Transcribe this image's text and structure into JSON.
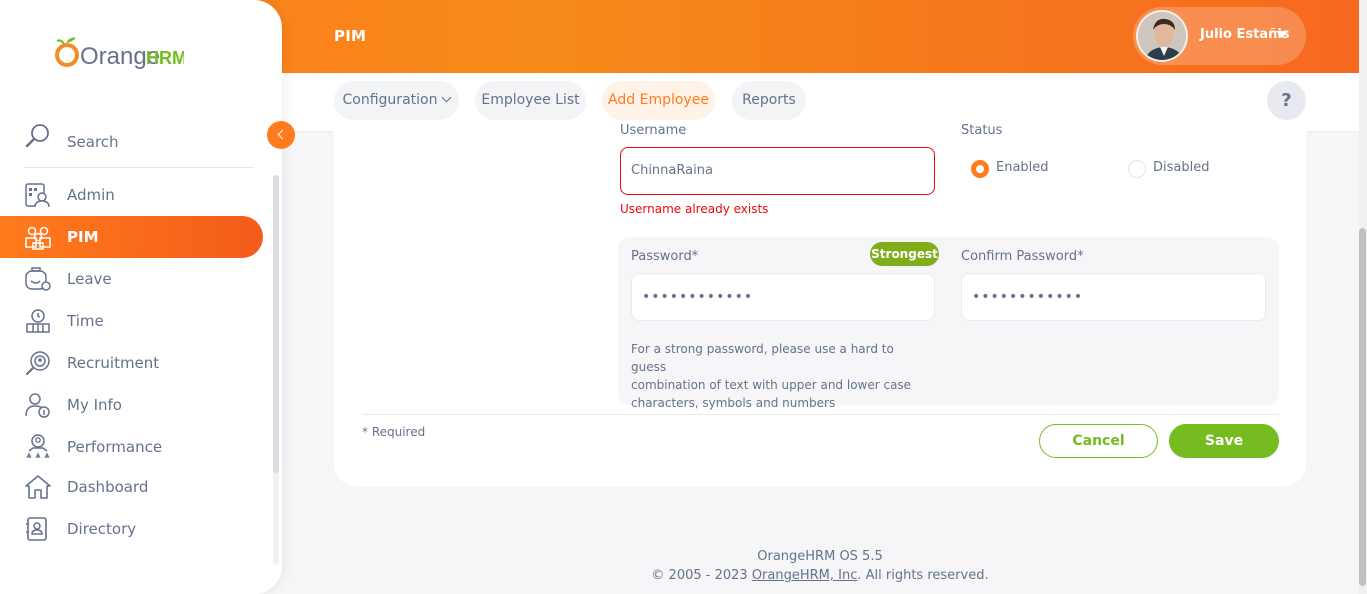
{
  "app": {
    "brand_part1": "Orange",
    "brand_part2": "HRM",
    "module_title": "PIM",
    "colors": {
      "accent": "#ff7b1d",
      "success": "#76bc21",
      "error": "#eb0910",
      "badge": "#80ae1b"
    }
  },
  "header": {
    "user_name": "Julio Estañis",
    "help_label": "?"
  },
  "tabs": [
    {
      "label": "Configuration"
    },
    {
      "label": "Employee List"
    },
    {
      "label": "Add Employee"
    },
    {
      "label": "Reports"
    }
  ],
  "sidebar": {
    "search_label": "Search",
    "items": [
      {
        "label": "Admin",
        "icon": "admin-icon"
      },
      {
        "label": "PIM",
        "icon": "pim-icon"
      },
      {
        "label": "Leave",
        "icon": "leave-icon"
      },
      {
        "label": "Time",
        "icon": "time-icon"
      },
      {
        "label": "Recruitment",
        "icon": "recruitment-icon"
      },
      {
        "label": "My Info",
        "icon": "my-info-icon"
      },
      {
        "label": "Performance",
        "icon": "performance-icon"
      },
      {
        "label": "Dashboard",
        "icon": "dashboard-icon"
      },
      {
        "label": "Directory",
        "icon": "directory-icon"
      }
    ]
  },
  "form": {
    "username_label": "Username",
    "username_value": "ChinnaRaina",
    "username_error": "Username already exists",
    "status_label": "Status",
    "status_enabled": "Enabled",
    "status_disabled": "Disabled",
    "password_label": "Password*",
    "password_value": "••••••••••••",
    "strength_badge": "Strongest",
    "confirm_label": "Confirm Password*",
    "confirm_value": "••••••••••••",
    "hint_line1": "For a strong password, please use a hard to guess",
    "hint_line2": "combination of text with upper and lower case",
    "hint_line3": "characters, symbols and numbers",
    "required_note": "* Required",
    "cancel_label": "Cancel",
    "save_label": "Save"
  },
  "footer": {
    "version": "OrangeHRM OS 5.5",
    "copyright_prefix": "© 2005 - 2023 ",
    "company_link": "OrangeHRM, Inc",
    "copyright_suffix": ". All rights reserved."
  }
}
